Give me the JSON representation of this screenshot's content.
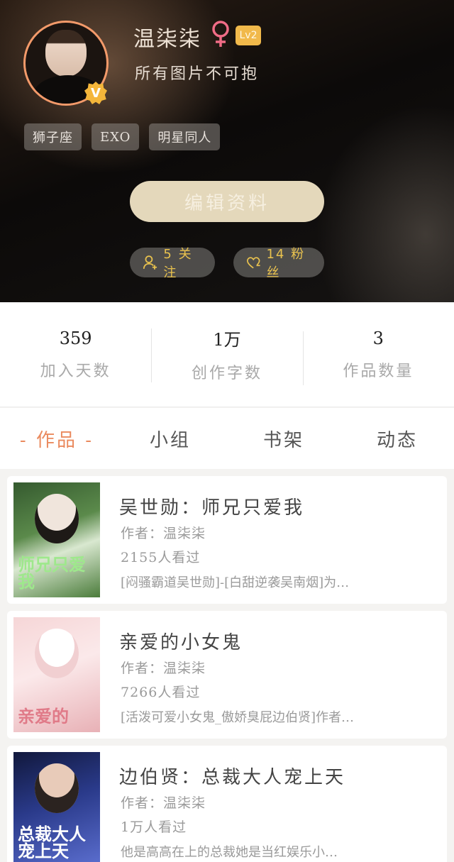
{
  "profile": {
    "name": "温柒柒",
    "level": "Lv2",
    "bio": "所有图片不可抱",
    "tags": [
      "狮子座",
      "EXO",
      "明星同人"
    ],
    "edit_label": "编辑资料",
    "follow_label": "5 关注",
    "fans_label": "14 粉丝"
  },
  "stats": [
    {
      "value": "359",
      "label": "加入天数"
    },
    {
      "value": "1万",
      "label": "创作字数"
    },
    {
      "value": "3",
      "label": "作品数量"
    }
  ],
  "tabs": [
    "作品",
    "小组",
    "书架",
    "动态"
  ],
  "books": [
    {
      "title": "吴世勋：师兄只爱我",
      "author": "作者：温柒柒",
      "views": "2155人看过",
      "desc": "[闷骚霸道吴世勋]-[白甜逆袭吴南烟]为…",
      "cover_text": "师兄只爱我"
    },
    {
      "title": "亲爱的小女鬼",
      "author": "作者：温柒柒",
      "views": "7266人看过",
      "desc": "[活泼可爱小女鬼_傲娇臭屁边伯贤]作者…",
      "cover_text": "亲爱的"
    },
    {
      "title": "边伯贤：总裁大人宠上天",
      "author": "作者：温柒柒",
      "views": "1万人看过",
      "desc": "他是高高在上的总裁她是当红娱乐小…",
      "cover_text": "总裁大人宠上天"
    }
  ],
  "colors": {
    "accent": "#ea8a5e",
    "gold": "#e9c24e",
    "edit_button": "#e4d8bb",
    "level_badge": "#f1b94b",
    "avatar_ring": "#f39a6a"
  }
}
